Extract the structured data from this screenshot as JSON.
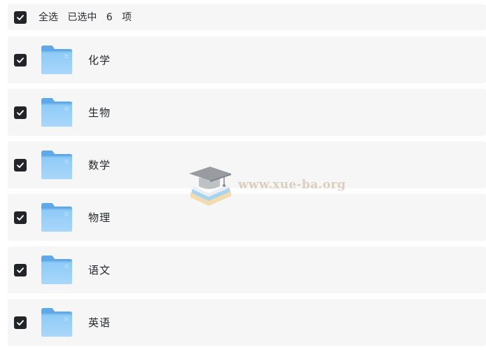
{
  "selection_bar": {
    "select_all_label": "全选",
    "selected_prefix": "已选中",
    "selected_count": "6",
    "selected_suffix": "项",
    "checked": true
  },
  "items": [
    {
      "label": "化学",
      "icon": "folder-icon",
      "checked": true
    },
    {
      "label": "生物",
      "icon": "folder-icon",
      "checked": true
    },
    {
      "label": "数学",
      "icon": "folder-icon",
      "checked": true
    },
    {
      "label": "物理",
      "icon": "folder-icon",
      "checked": true
    },
    {
      "label": "语文",
      "icon": "folder-icon",
      "checked": true
    },
    {
      "label": "英语",
      "icon": "folder-icon",
      "checked": true
    }
  ],
  "watermark": {
    "text": "www.xue-ba.org",
    "icon": "graduation-cap-icon"
  },
  "colors": {
    "row_background": "#f6f6f7",
    "checkbox_fill": "#222428",
    "folder_blue": "#7dbdf0",
    "text": "#25272b"
  }
}
